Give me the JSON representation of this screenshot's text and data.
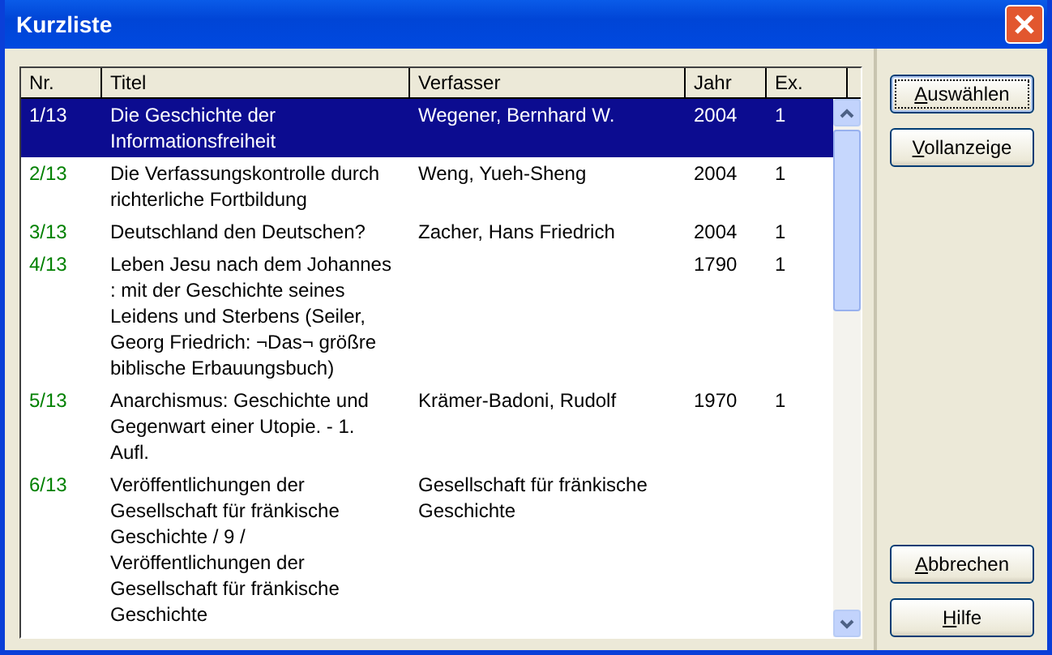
{
  "window": {
    "title": "Kurzliste"
  },
  "table": {
    "columns": [
      "Nr.",
      "Titel",
      "Verfasser",
      "Jahr",
      "Ex."
    ],
    "rows": [
      {
        "nr": "1/13",
        "titel": "Die Geschichte der Informationsfreiheit",
        "verfasser": "Wegener, Bernhard W.",
        "jahr": "2004",
        "ex": "1",
        "selected": true
      },
      {
        "nr": "2/13",
        "titel": "Die Verfassungskontrolle durch richterliche Fortbildung",
        "verfasser": "Weng, Yueh-Sheng",
        "jahr": "2004",
        "ex": "1",
        "selected": false
      },
      {
        "nr": "3/13",
        "titel": "Deutschland den Deutschen?",
        "verfasser": "Zacher, Hans Friedrich",
        "jahr": "2004",
        "ex": "1",
        "selected": false
      },
      {
        "nr": "4/13",
        "titel": "Leben Jesu nach dem Johannes : mit der Geschichte seines Leidens und Sterbens (Seiler, Georg Friedrich: ¬Das¬ größre biblische Erbauungsbuch)",
        "verfasser": "",
        "jahr": "1790",
        "ex": "1",
        "selected": false
      },
      {
        "nr": "5/13",
        "titel": "Anarchismus: Geschichte und Gegenwart einer Utopie. - 1. Aufl.",
        "verfasser": "Krämer-Badoni, Rudolf",
        "jahr": "1970",
        "ex": "1",
        "selected": false
      },
      {
        "nr": "6/13",
        "titel": "Veröffentlichungen der Gesellschaft für fränkische Geschichte / 9 / Veröffentlichungen der Gesellschaft für fränkische Geschichte",
        "verfasser": "Gesellschaft für fränkische Geschichte",
        "jahr": "",
        "ex": "",
        "selected": false
      }
    ]
  },
  "buttons_top": [
    {
      "access_key": "A",
      "label_rest": "uswählen",
      "default": true
    },
    {
      "access_key": "V",
      "label_rest": "ollanzeige",
      "default": false
    }
  ],
  "buttons_bottom": [
    {
      "access_key": "A",
      "label_rest": "bbrechen",
      "default": false
    },
    {
      "access_key": "H",
      "label_rest": "ilfe",
      "default": false
    }
  ]
}
